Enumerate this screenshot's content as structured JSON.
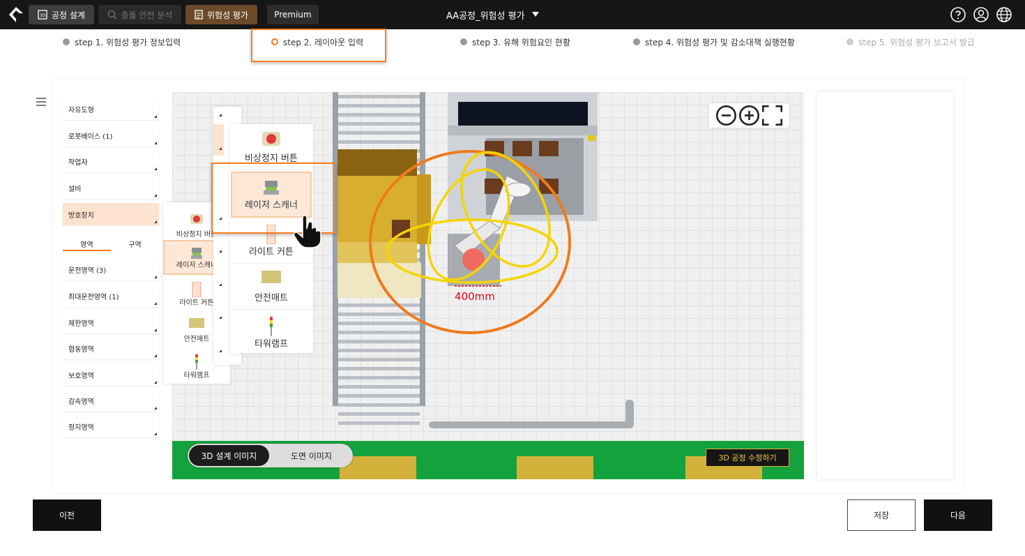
{
  "topbar": {
    "tabs": [
      {
        "label": "공정 설계"
      },
      {
        "label": "충돌 안전 분석"
      },
      {
        "label": "위험성 평가"
      },
      {
        "label": "Premium"
      }
    ],
    "project_title": "AA공정_위험성 평가"
  },
  "steps": [
    {
      "label": "step 1. 위험성 평가 정보입력",
      "state": "done"
    },
    {
      "label": "step 2. 레이아웃 입력",
      "state": "active"
    },
    {
      "label": "step 3. 유해 위험요인 현황",
      "state": "done"
    },
    {
      "label": "step 4. 위험성 평가 및 감소대책 실행현황",
      "state": "done"
    },
    {
      "label": "step 5. 위험성 평가 보고서 발급",
      "state": "disabled"
    }
  ],
  "left_panel": {
    "categories": [
      {
        "label": "자유도형"
      },
      {
        "label": "로봇베이스 (1)"
      },
      {
        "label": "작업자"
      },
      {
        "label": "설비"
      },
      {
        "label": "방호장치"
      }
    ],
    "tabs": [
      "영역",
      "구역"
    ],
    "zones": [
      {
        "label": "운전영역 (3)"
      },
      {
        "label": "최대운전영역 (1)"
      },
      {
        "label": "제한영역"
      },
      {
        "label": "협동영역"
      },
      {
        "label": "보호영역"
      },
      {
        "label": "감속영역"
      },
      {
        "label": "정지영역"
      }
    ]
  },
  "devices_small": [
    "비상정지 버튼",
    "레이저 스캐너",
    "라이트 커튼",
    "안전매트",
    "타워램프"
  ],
  "devices_large": [
    "비상정지 버튼",
    "레이저 스캐너",
    "라이트 커튼",
    "안전매트",
    "타워램프"
  ],
  "canvas": {
    "measurement": "400mm",
    "view_options": [
      "3D 설계 이미지",
      "도면 이미지"
    ],
    "edit_button": "3D 공정 수정하기"
  },
  "footer": {
    "prev": "이전",
    "save": "저장",
    "next": "다음"
  },
  "colors": {
    "accent": "#ff7a1a",
    "topbar": "#161616",
    "risk_tab": "#6b4a2a"
  }
}
